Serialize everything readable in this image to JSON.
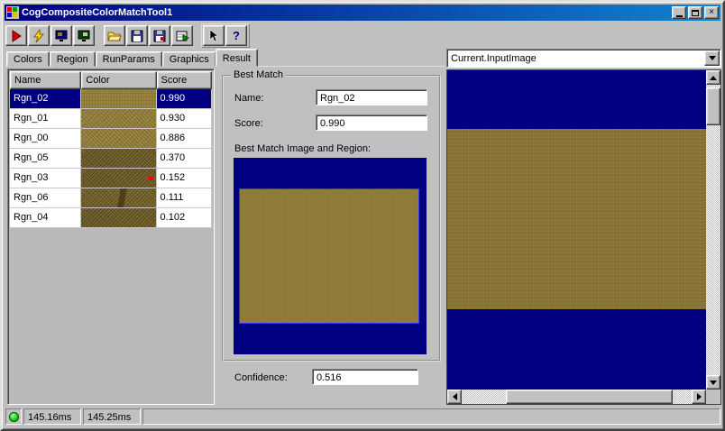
{
  "window": {
    "title": "CogCompositeColorMatchTool1"
  },
  "titlebar": {
    "close_glyph": "×"
  },
  "toolbar": {
    "icons": [
      "run-icon",
      "live-run-icon",
      "image-display-a-icon",
      "image-display-b-icon",
      "open-file-icon",
      "save-icon",
      "save-image-icon",
      "import-icon",
      "pointer-icon",
      "help-icon"
    ],
    "help_glyph": "?"
  },
  "tabs": {
    "items": [
      "Colors",
      "Region",
      "RunParams",
      "Graphics",
      "Result"
    ],
    "active": "Result"
  },
  "results_table": {
    "columns": [
      "Name",
      "Color",
      "Score"
    ],
    "rows": [
      {
        "name": "Rgn_02",
        "score": "0.990",
        "swatch": "tan-texture",
        "selected": true
      },
      {
        "name": "Rgn_01",
        "score": "0.930",
        "swatch": "tan-texture"
      },
      {
        "name": "Rgn_00",
        "score": "0.886",
        "swatch": "tan-texture"
      },
      {
        "name": "Rgn_05",
        "score": "0.370",
        "swatch": "speckled-tan-texture"
      },
      {
        "name": "Rgn_03",
        "score": "0.152",
        "swatch": "speckled-tan-texture-with-red-marker"
      },
      {
        "name": "Rgn_06",
        "score": "0.111",
        "swatch": "streaked-tan-texture"
      },
      {
        "name": "Rgn_04",
        "score": "0.102",
        "swatch": "speckled-tan-texture"
      }
    ]
  },
  "best_match": {
    "group_label": "Best Match",
    "name_label": "Name:",
    "name_value": "Rgn_02",
    "score_label": "Score:",
    "score_value": "0.990",
    "image_caption": "Best Match Image and Region:",
    "confidence_label": "Confidence:",
    "confidence_value": "0.516"
  },
  "image_panel": {
    "source_selector_value": "Current.InputImage"
  },
  "status_bar": {
    "run_time": "145.16ms",
    "total_time": "145.25ms"
  },
  "colors": {
    "titlebar_gradient_start": "#000080",
    "titlebar_gradient_end": "#1084d0",
    "selection": "#000080",
    "image_background_navy": "#000080",
    "match_region_tan": "#93803c",
    "window_chrome": "#c0c0c0",
    "match_region_outline": "#3a3ae8",
    "status_led": "#00d000"
  }
}
